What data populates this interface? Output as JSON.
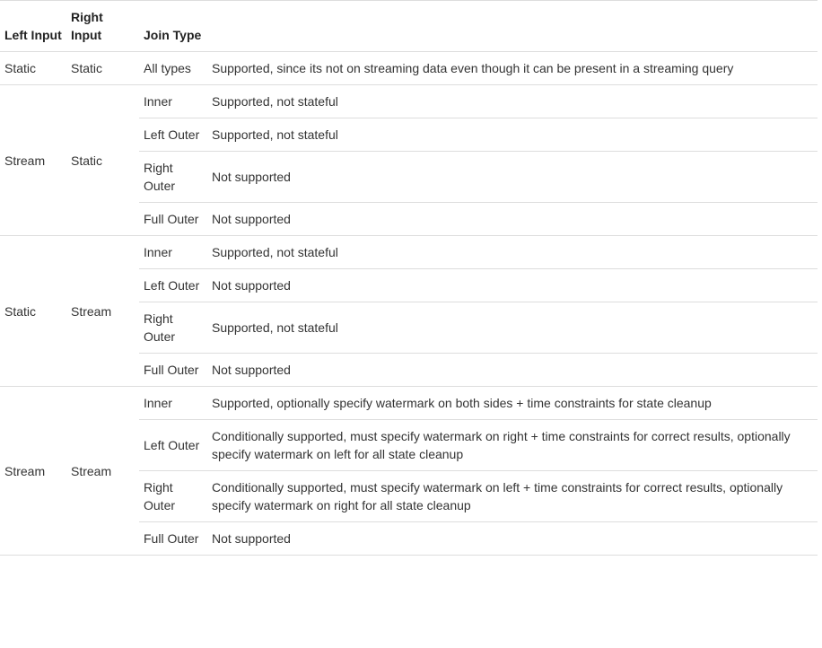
{
  "table": {
    "headers": [
      "Left Input",
      "Right Input",
      "Join Type",
      ""
    ],
    "groups": [
      {
        "left": "Static",
        "right": "Static",
        "rows": [
          {
            "join": "All types",
            "desc": "Supported, since its not on streaming data even though it can be present in a streaming query"
          }
        ]
      },
      {
        "left": "Stream",
        "right": "Static",
        "rows": [
          {
            "join": "Inner",
            "desc": "Supported, not stateful"
          },
          {
            "join": "Left Outer",
            "desc": "Supported, not stateful"
          },
          {
            "join": "Right Outer",
            "desc": "Not supported"
          },
          {
            "join": "Full Outer",
            "desc": "Not supported"
          }
        ]
      },
      {
        "left": "Static",
        "right": "Stream",
        "rows": [
          {
            "join": "Inner",
            "desc": "Supported, not stateful"
          },
          {
            "join": "Left Outer",
            "desc": "Not supported"
          },
          {
            "join": "Right Outer",
            "desc": "Supported, not stateful"
          },
          {
            "join": "Full Outer",
            "desc": "Not supported"
          }
        ]
      },
      {
        "left": "Stream",
        "right": "Stream",
        "rows": [
          {
            "join": "Inner",
            "desc": "Supported, optionally specify watermark on both sides + time constraints for state cleanup"
          },
          {
            "join": "Left Outer",
            "desc": "Conditionally supported, must specify watermark on right + time constraints for correct results, optionally specify watermark on left for all state cleanup"
          },
          {
            "join": "Right Outer",
            "desc": "Conditionally supported, must specify watermark on left + time constraints for correct results, optionally specify watermark on right for all state cleanup"
          },
          {
            "join": "Full Outer",
            "desc": "Not supported"
          }
        ]
      }
    ]
  }
}
